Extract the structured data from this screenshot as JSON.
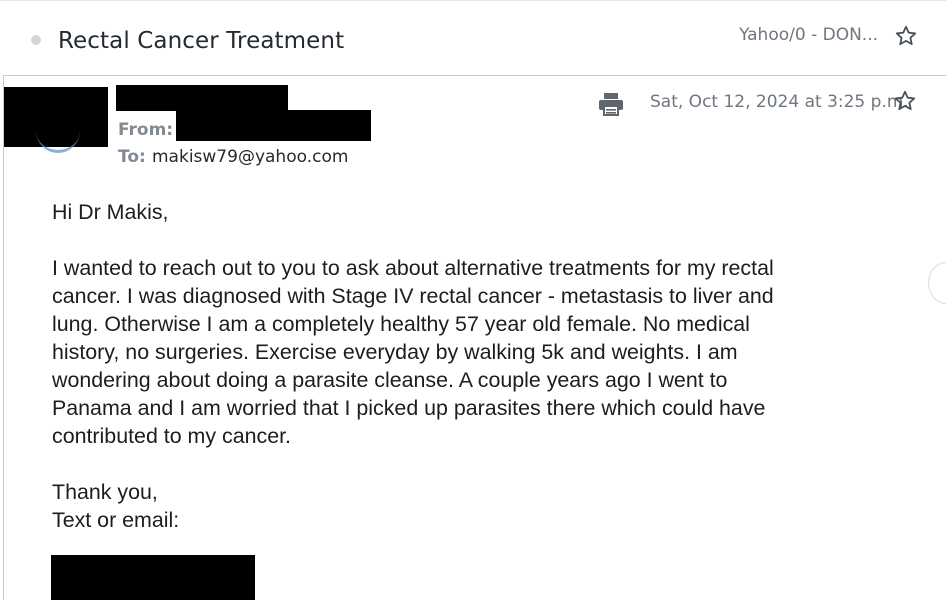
{
  "subject": {
    "title": "Rectal Cancer Treatment",
    "folder": "Yahoo/0 - DON..."
  },
  "message": {
    "from_label": "From:",
    "to_label": "To:",
    "to_address": "makisw79@yahoo.com",
    "date": "Sat, Oct 12, 2024 at 3:25 p.m."
  },
  "body": {
    "greeting": "Hi Dr Makis,",
    "paragraph": "I wanted to reach out to you to ask about alternative treatments for my rectal\ncancer. I was diagnosed with Stage IV rectal cancer - metastasis to liver and\nlung. Otherwise I am a completely healthy 57 year old female. No medical\nhistory, no surgeries. Exercise everyday by walking 5k and weights. I am\nwondering about doing a parasite cleanse. A couple years ago I went to\nPanama and I am worried that I picked up parasites there which could have\ncontributed to my cancer.",
    "closing": "Thank you,\nText or email:"
  },
  "icons": {
    "subject_star": "star-outline-icon",
    "print": "printer-icon",
    "message_star": "star-outline-icon"
  },
  "colors": {
    "text_primary": "#232a31",
    "text_secondary": "#6e7780",
    "redaction": "#000000",
    "border": "#c6cbd1"
  }
}
